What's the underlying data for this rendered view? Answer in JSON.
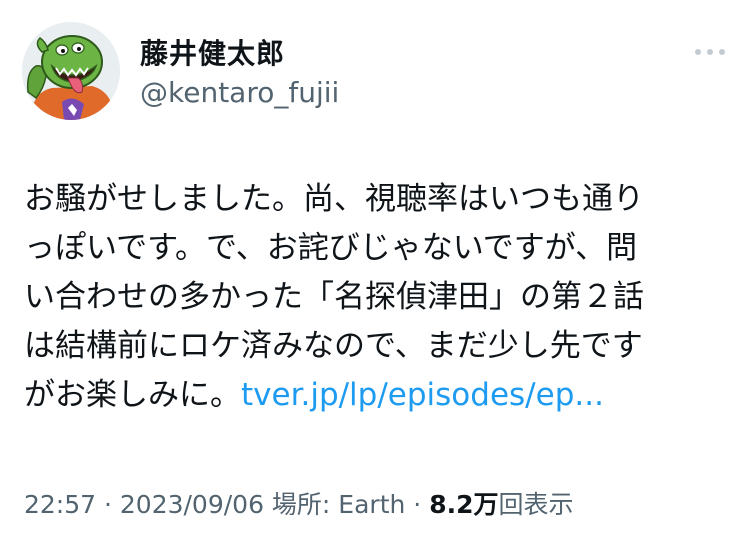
{
  "author": {
    "display_name": "藤井健太郎",
    "handle": "@kentaro_fujii",
    "avatar_icon": "cartoon-monster-avatar-icon"
  },
  "more_icon": "more-horizontal-icon",
  "tweet": {
    "lines": [
      "お騒がせしました。尚、視聴率はいつも通り",
      "っぽいです。で、お詫びじゃないですが、問",
      "い合わせの多かった「名探偵津田」の第２話",
      "は結構前にロケ済みなので、まだ少し先です"
    ],
    "last_line_text": "がお楽しみに。",
    "link_text": "tver.jp/lp/episodes/ep..."
  },
  "meta": {
    "time": "22:57",
    "separator1": " · ",
    "date": "2023/09/06",
    "location_text": " 場所: Earth",
    "separator2": " · ",
    "views_count": "8.2万",
    "views_label": "回表示"
  },
  "colors": {
    "link": "#1d9bf0",
    "secondary_text": "#536471",
    "primary_text": "#0f1419"
  }
}
